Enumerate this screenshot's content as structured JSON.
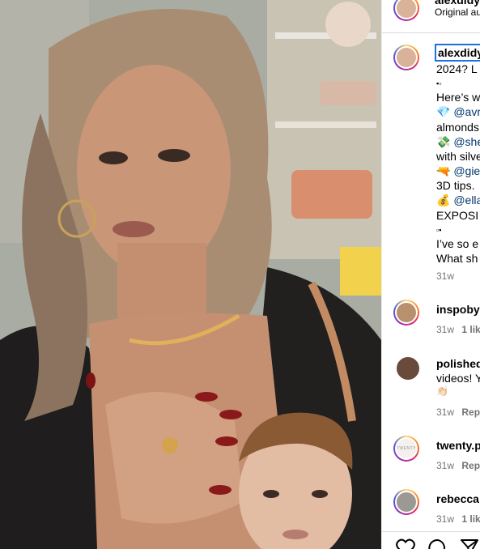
{
  "header": {
    "username": "alexdidy",
    "subtitle": "Original au"
  },
  "caption": {
    "author": "alexdidy",
    "lines": [
      "2024? L",
      "▪▫",
      "Here’s w",
      "@avr",
      "almonds",
      "@she",
      "with silve",
      "@gie",
      "3D tips.",
      "@ella",
      "EXPOSI",
      "▫▪",
      "I’ve so e",
      "What sh"
    ],
    "emojis": [
      "💎",
      "💸",
      "🔫",
      "💰"
    ],
    "time": "31w"
  },
  "comments": [
    {
      "username": "inspobyr",
      "text": "",
      "time": "31w",
      "action": "1 lik"
    },
    {
      "username": "polished",
      "text": "videos! Y",
      "text2": "👏🏻",
      "time": "31w",
      "action": "Rep"
    },
    {
      "username": "twenty.p",
      "text": "",
      "time": "31w",
      "action": "Rep",
      "avatar_text": "TWENTY"
    },
    {
      "username": "rebecca",
      "text": "",
      "time": "31w",
      "action": "1 lik"
    }
  ],
  "colors": {
    "link": "#00376b",
    "meta": "#737373",
    "selection": "#1d6fe3"
  },
  "icons": [
    "heart-icon",
    "comment-icon",
    "share-icon"
  ]
}
